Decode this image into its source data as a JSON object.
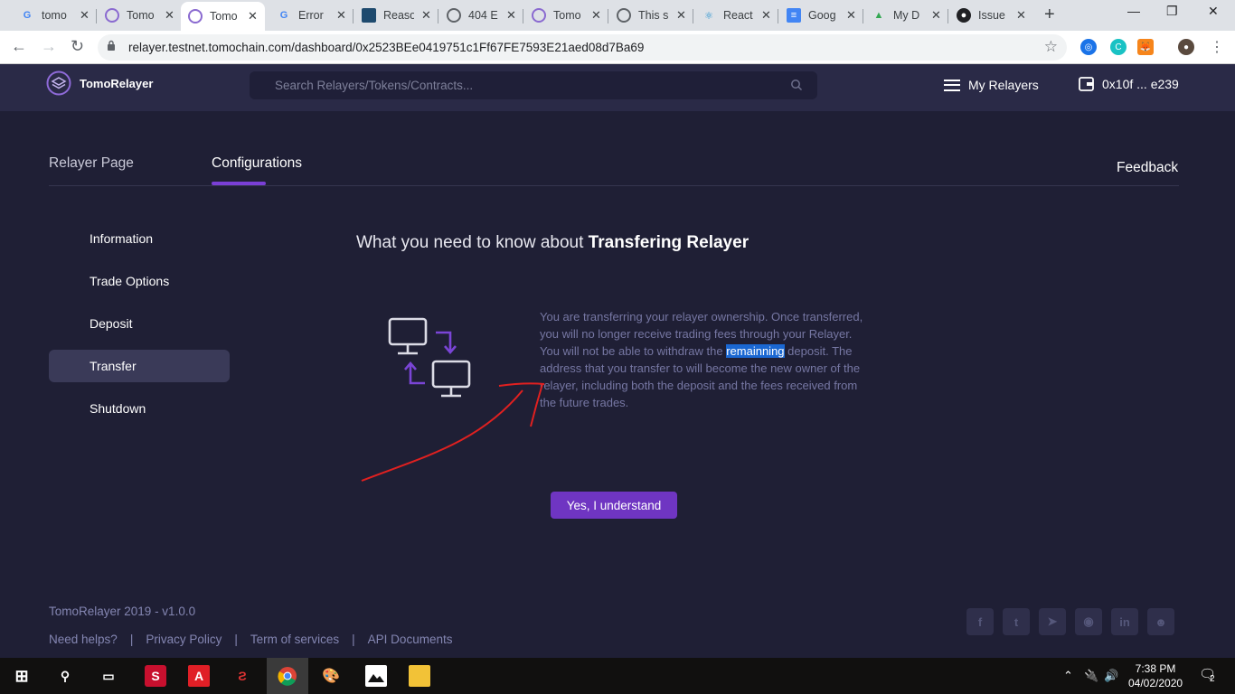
{
  "browser": {
    "tabs": [
      {
        "title": "tomo",
        "icon": "google-icon"
      },
      {
        "title": "Tomo",
        "icon": "tomo-icon"
      },
      {
        "title": "Tomo",
        "icon": "tomo-icon"
      },
      {
        "title": "Error",
        "icon": "google-icon"
      },
      {
        "title": "Reaso",
        "icon": "reasonml-icon"
      },
      {
        "title": "404 E",
        "icon": "globe-icon"
      },
      {
        "title": "Tomo",
        "icon": "tomo-icon"
      },
      {
        "title": "This s",
        "icon": "globe-icon"
      },
      {
        "title": "React",
        "icon": "react-icon"
      },
      {
        "title": "Goog",
        "icon": "docs-icon"
      },
      {
        "title": "My D",
        "icon": "drive-icon"
      },
      {
        "title": "Issue",
        "icon": "github-icon"
      }
    ],
    "url": "relayer.testnet.tomochain.com/dashboard/0x2523BEe0419751c1Ff67FE7593E21aed08d7Ba69"
  },
  "header": {
    "brand": "TomoRelayer",
    "search_placeholder": "Search Relayers/Tokens/Contracts...",
    "my_relayers": "My Relayers",
    "wallet": "0x10f ... e239"
  },
  "tabs": {
    "relayer_page": "Relayer Page",
    "configurations": "Configurations",
    "feedback": "Feedback"
  },
  "sidebar": {
    "items": [
      {
        "label": "Information"
      },
      {
        "label": "Trade Options"
      },
      {
        "label": "Deposit"
      },
      {
        "label": "Transfer"
      },
      {
        "label": "Shutdown"
      }
    ]
  },
  "content": {
    "heading_prefix": "What you need to know about ",
    "heading_bold": "Transfering Relayer",
    "para_part1": "You are transferring your relayer ownership. Once transferred, you will no longer receive trading fees through your Relayer. You will not be able to withdraw the ",
    "para_highlight": "remainning",
    "para_part2": " deposit. The address that you transfer to will become the new owner of the relayer, including both the deposit and the fees received from the future trades.",
    "confirm_label": "Yes, I understand"
  },
  "footer": {
    "copyright": "TomoRelayer 2019 - v1.0.0",
    "links": [
      "Need helps?",
      "Privacy Policy",
      "Term of services",
      "API Documents"
    ],
    "social": [
      {
        "icon": "facebook-icon",
        "glyph": "f"
      },
      {
        "icon": "twitter-icon",
        "glyph": "t"
      },
      {
        "icon": "telegram-icon",
        "glyph": "➤"
      },
      {
        "icon": "github-icon",
        "glyph": "◉"
      },
      {
        "icon": "linkedin-icon",
        "glyph": "in"
      },
      {
        "icon": "reddit-icon",
        "glyph": "☻"
      }
    ]
  },
  "taskbar": {
    "time": "7:38 PM",
    "date": "04/02/2020",
    "notifications": "2"
  },
  "colors": {
    "background": "#1f1f35",
    "header": "#2a2a47",
    "accent": "#6f35c2",
    "highlight": "#1a67d2",
    "annotation": "#e02020"
  }
}
